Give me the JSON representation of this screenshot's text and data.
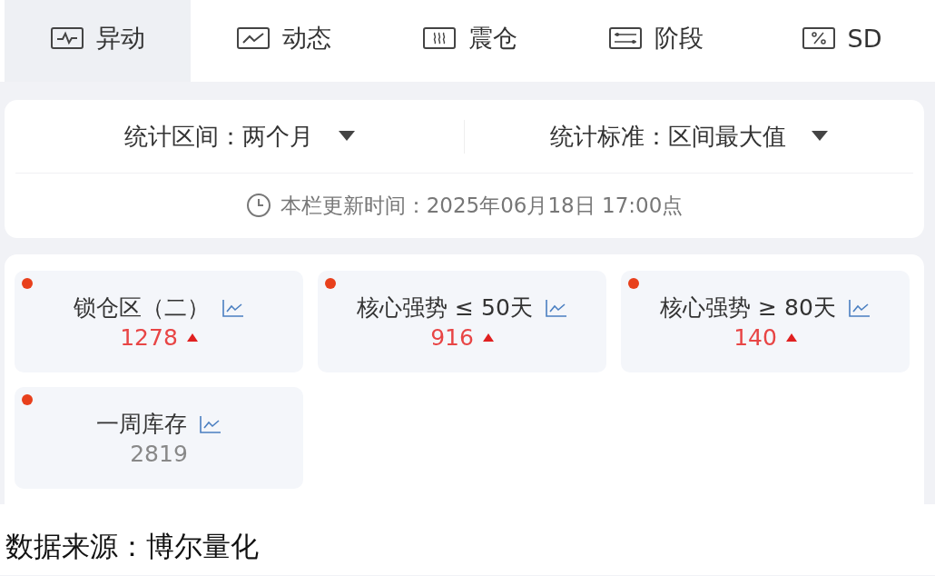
{
  "tabs": [
    {
      "kind": "pulse",
      "label": "异动",
      "selected": true
    },
    {
      "kind": "trend",
      "label": "动态",
      "selected": false
    },
    {
      "kind": "waves",
      "label": "震仓",
      "selected": false
    },
    {
      "kind": "sliders",
      "label": "阶段",
      "selected": false
    },
    {
      "kind": "percent",
      "label": "SD",
      "selected": false
    }
  ],
  "filters": [
    {
      "label": "统计区间：",
      "value": "两个月"
    },
    {
      "label": "统计标准：",
      "value": "区间最大值"
    }
  ],
  "update_time": "本栏更新时间：2025年06月18日 17:00点",
  "cards": [
    {
      "title": "锁仓区（二）",
      "value": "1278",
      "rising": true
    },
    {
      "title": "核心强势 ≤ 50天",
      "value": "916",
      "rising": true
    },
    {
      "title": "核心强势 ≥ 80天",
      "value": "140",
      "rising": true
    },
    {
      "title": "一周库存",
      "value": "2819",
      "rising": false
    }
  ],
  "source": "数据来源：博尔量化"
}
